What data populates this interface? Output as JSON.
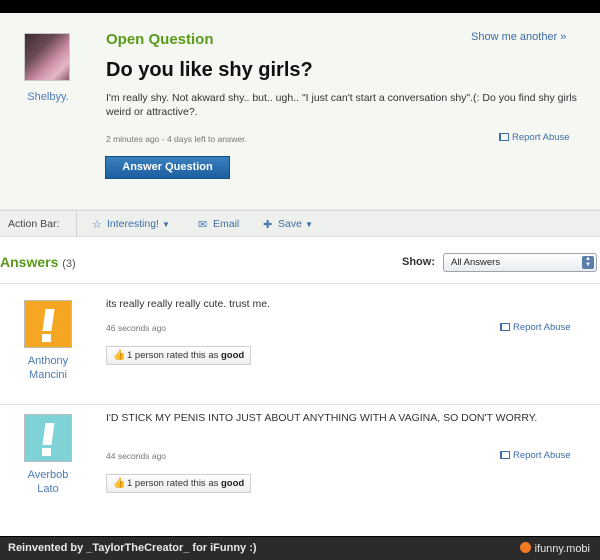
{
  "question": {
    "asker_name": "Shelbyy.",
    "type_label": "Open Question",
    "show_another": "Show me another »",
    "title": "Do you like shy girls?",
    "body": "I'm really shy. Not akward shy.. but.. ugh.. \"I just can't start a conversation shy\".(: Do you find shy girls weird or attractive?.",
    "meta": "2 minutes ago - 4 days left to answer.",
    "report_label": "Report Abuse",
    "answer_button": "Answer Question"
  },
  "action_bar": {
    "label": "Action Bar:",
    "interesting": "Interesting!",
    "email": "Email",
    "save": "Save"
  },
  "answers_header": {
    "title": "Answers",
    "count": "(3)",
    "show_label": "Show:",
    "show_value": "All Answers"
  },
  "answers": [
    {
      "name": "Anthony Mancini",
      "text": "its really really really cute. trust me.",
      "time": "46 seconds ago",
      "report_label": "Report Abuse",
      "rating_text": "1 person rated this as",
      "rating_value": "good",
      "avatar_color": "#f5a623"
    },
    {
      "name": "Averbob Lato",
      "text": "I'D STICK MY PENIS INTO JUST ABOUT ANYTHING WITH A VAGINA, SO DON'T WORRY.",
      "time": "44 seconds ago",
      "report_label": "Report Abuse",
      "rating_text": "1 person rated this as",
      "rating_value": "good",
      "avatar_color": "#7fd3d6"
    }
  ],
  "footer": {
    "left": "Reinvented by _TaylorTheCreator_ for iFunny :)",
    "right": "ifunny.mobi"
  },
  "colors": {
    "green_heading": "#5a9a1a",
    "link_blue": "#3d6ea8",
    "button_blue": "#2a6fb0"
  }
}
